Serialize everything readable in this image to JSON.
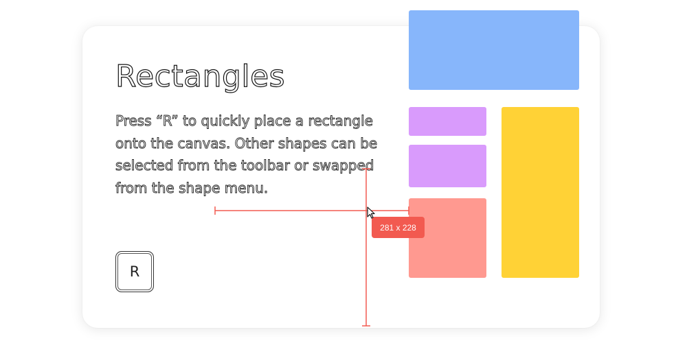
{
  "heading": "Rectangles",
  "description": "Press “R” to quickly place a rectangle onto the canvas. Other shapes can be selected from the toolbar or swapped from the shape menu.",
  "shortcut_key": "R",
  "size_label": "281 x 228",
  "colors": {
    "blue": "#87b6fb",
    "purple": "#d99bfc",
    "yellow": "#ffd236",
    "red": "#ff9990",
    "guide": "#f25a50"
  }
}
